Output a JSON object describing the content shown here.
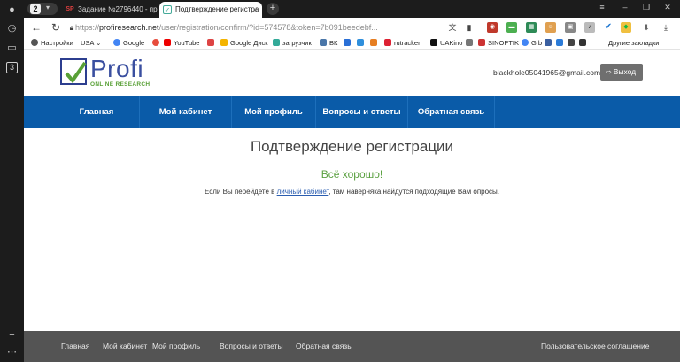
{
  "browser": {
    "tab_count": "2",
    "tabs": [
      {
        "icon": "SP",
        "label": "Задание №2796440 - про",
        "close": "×"
      },
      {
        "icon": "✓",
        "label": "Подтверждение регистра",
        "close": "×"
      }
    ],
    "new_tab": "+",
    "url_prefix": "https://",
    "url_host": "profiresearch.net",
    "url_path": "/user/registration/confirm/?id=574578&token=7b091beedebf...",
    "bookmarks": [
      "Настройки",
      "USA ⌄",
      "Google",
      "",
      "YouTube",
      "",
      "Google Диск",
      "загрузчик",
      "ВК",
      "",
      "",
      "",
      "rutracker",
      "UAKino",
      "",
      "SINOPTIK",
      "G b",
      "",
      "",
      "",
      "",
      "Другие закладки"
    ]
  },
  "sidebar": {
    "badge": "3"
  },
  "site": {
    "logo_brand": "Profi",
    "logo_sub": "ONLINE RESEARCH",
    "email": "blackhole05041965@gmail.com",
    "logout_label": "Выход",
    "nav": [
      "Главная",
      "Мой кабинет",
      "Мой профиль",
      "Вопросы и ответы",
      "Обратная связь"
    ],
    "title": "Подтверждение регистрации",
    "success": "Всё хорошо!",
    "msg_before": "Если Вы перейдете в ",
    "msg_link": "личный кабинет",
    "msg_after": ", там наверняка найдутся подходящие Вам опросы.",
    "footer_links": [
      "Главная",
      "Мой кабинет",
      "Мой профиль",
      "Вопросы и ответы",
      "Обратная связь"
    ],
    "footer_agreement": "Пользовательское соглашение"
  },
  "colors": {
    "nav_bg": "#0a5ba8",
    "footer_bg": "#545454",
    "success": "#5aa040",
    "brand": "#3a4fa0"
  }
}
